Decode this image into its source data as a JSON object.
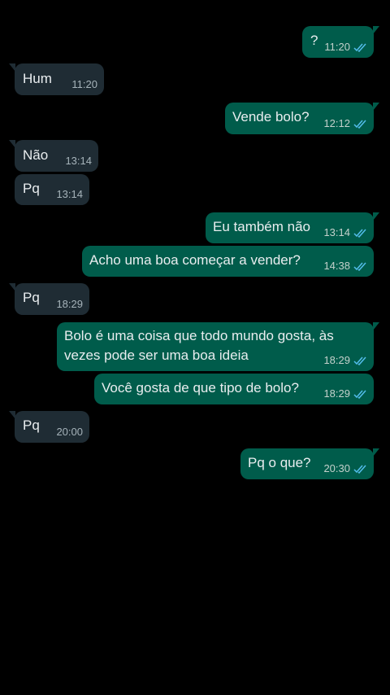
{
  "colors": {
    "background": "#000000",
    "incoming_bubble": "#1f2c34",
    "outgoing_bubble": "#005c4b",
    "text": "#e9edef",
    "read_ticks": "#53bdeb"
  },
  "messages": [
    {
      "direction": "out",
      "text": "?",
      "time": "11:20",
      "status_icon": "double-check-read-icon"
    },
    {
      "direction": "in",
      "text": "Hum",
      "time": "11:20"
    },
    {
      "direction": "out",
      "text": "Vende bolo?",
      "time": "12:12",
      "status_icon": "double-check-read-icon"
    },
    {
      "direction": "in",
      "text": "Não",
      "time": "13:14"
    },
    {
      "direction": "in",
      "text": "Pq",
      "time": "13:14"
    },
    {
      "direction": "out",
      "text": "Eu também não",
      "time": "13:14",
      "status_icon": "double-check-read-icon"
    },
    {
      "direction": "out",
      "text": "Acho uma boa começar a vender?",
      "time": "14:38",
      "status_icon": "double-check-read-icon"
    },
    {
      "direction": "in",
      "text": "Pq",
      "time": "18:29"
    },
    {
      "direction": "out",
      "text": "Bolo é uma coisa que todo mundo gosta, às vezes pode ser uma boa ideia",
      "time": "18:29",
      "status_icon": "double-check-read-icon"
    },
    {
      "direction": "out",
      "text": "Você gosta de que tipo de bolo?",
      "time": "18:29",
      "status_icon": "double-check-read-icon"
    },
    {
      "direction": "in",
      "text": "Pq",
      "time": "20:00"
    },
    {
      "direction": "out",
      "text": "Pq o que?",
      "time": "20:30",
      "status_icon": "double-check-read-icon"
    }
  ]
}
